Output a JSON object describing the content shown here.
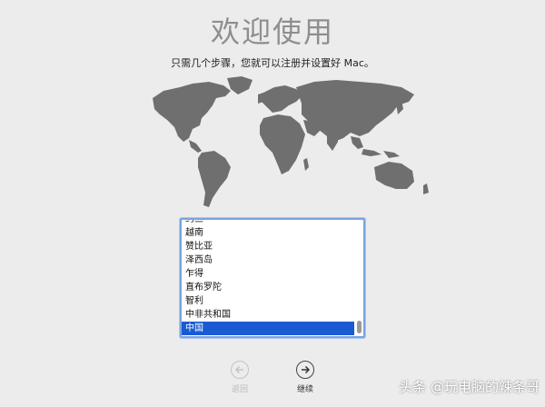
{
  "window": {
    "title": "欢迎使用",
    "subtitle": "只需几个步骤，您就可以注册并设置好 Mac。"
  },
  "country_list": {
    "items": [
      {
        "label": "约旦",
        "selected": false
      },
      {
        "label": "越南",
        "selected": false
      },
      {
        "label": "赞比亚",
        "selected": false
      },
      {
        "label": "泽西岛",
        "selected": false
      },
      {
        "label": "乍得",
        "selected": false
      },
      {
        "label": "直布罗陀",
        "selected": false
      },
      {
        "label": "智利",
        "selected": false
      },
      {
        "label": "中非共和国",
        "selected": false
      },
      {
        "label": "中国",
        "selected": true
      }
    ],
    "selected_color": "#1a5bd4"
  },
  "navigation": {
    "back_label": "返回",
    "continue_label": "继续"
  },
  "watermark": "头条 @玩电脑的辣条哥",
  "icons": {
    "map": "world-map-icon",
    "back": "arrow-left-circle-icon",
    "continue": "arrow-right-circle-icon"
  }
}
